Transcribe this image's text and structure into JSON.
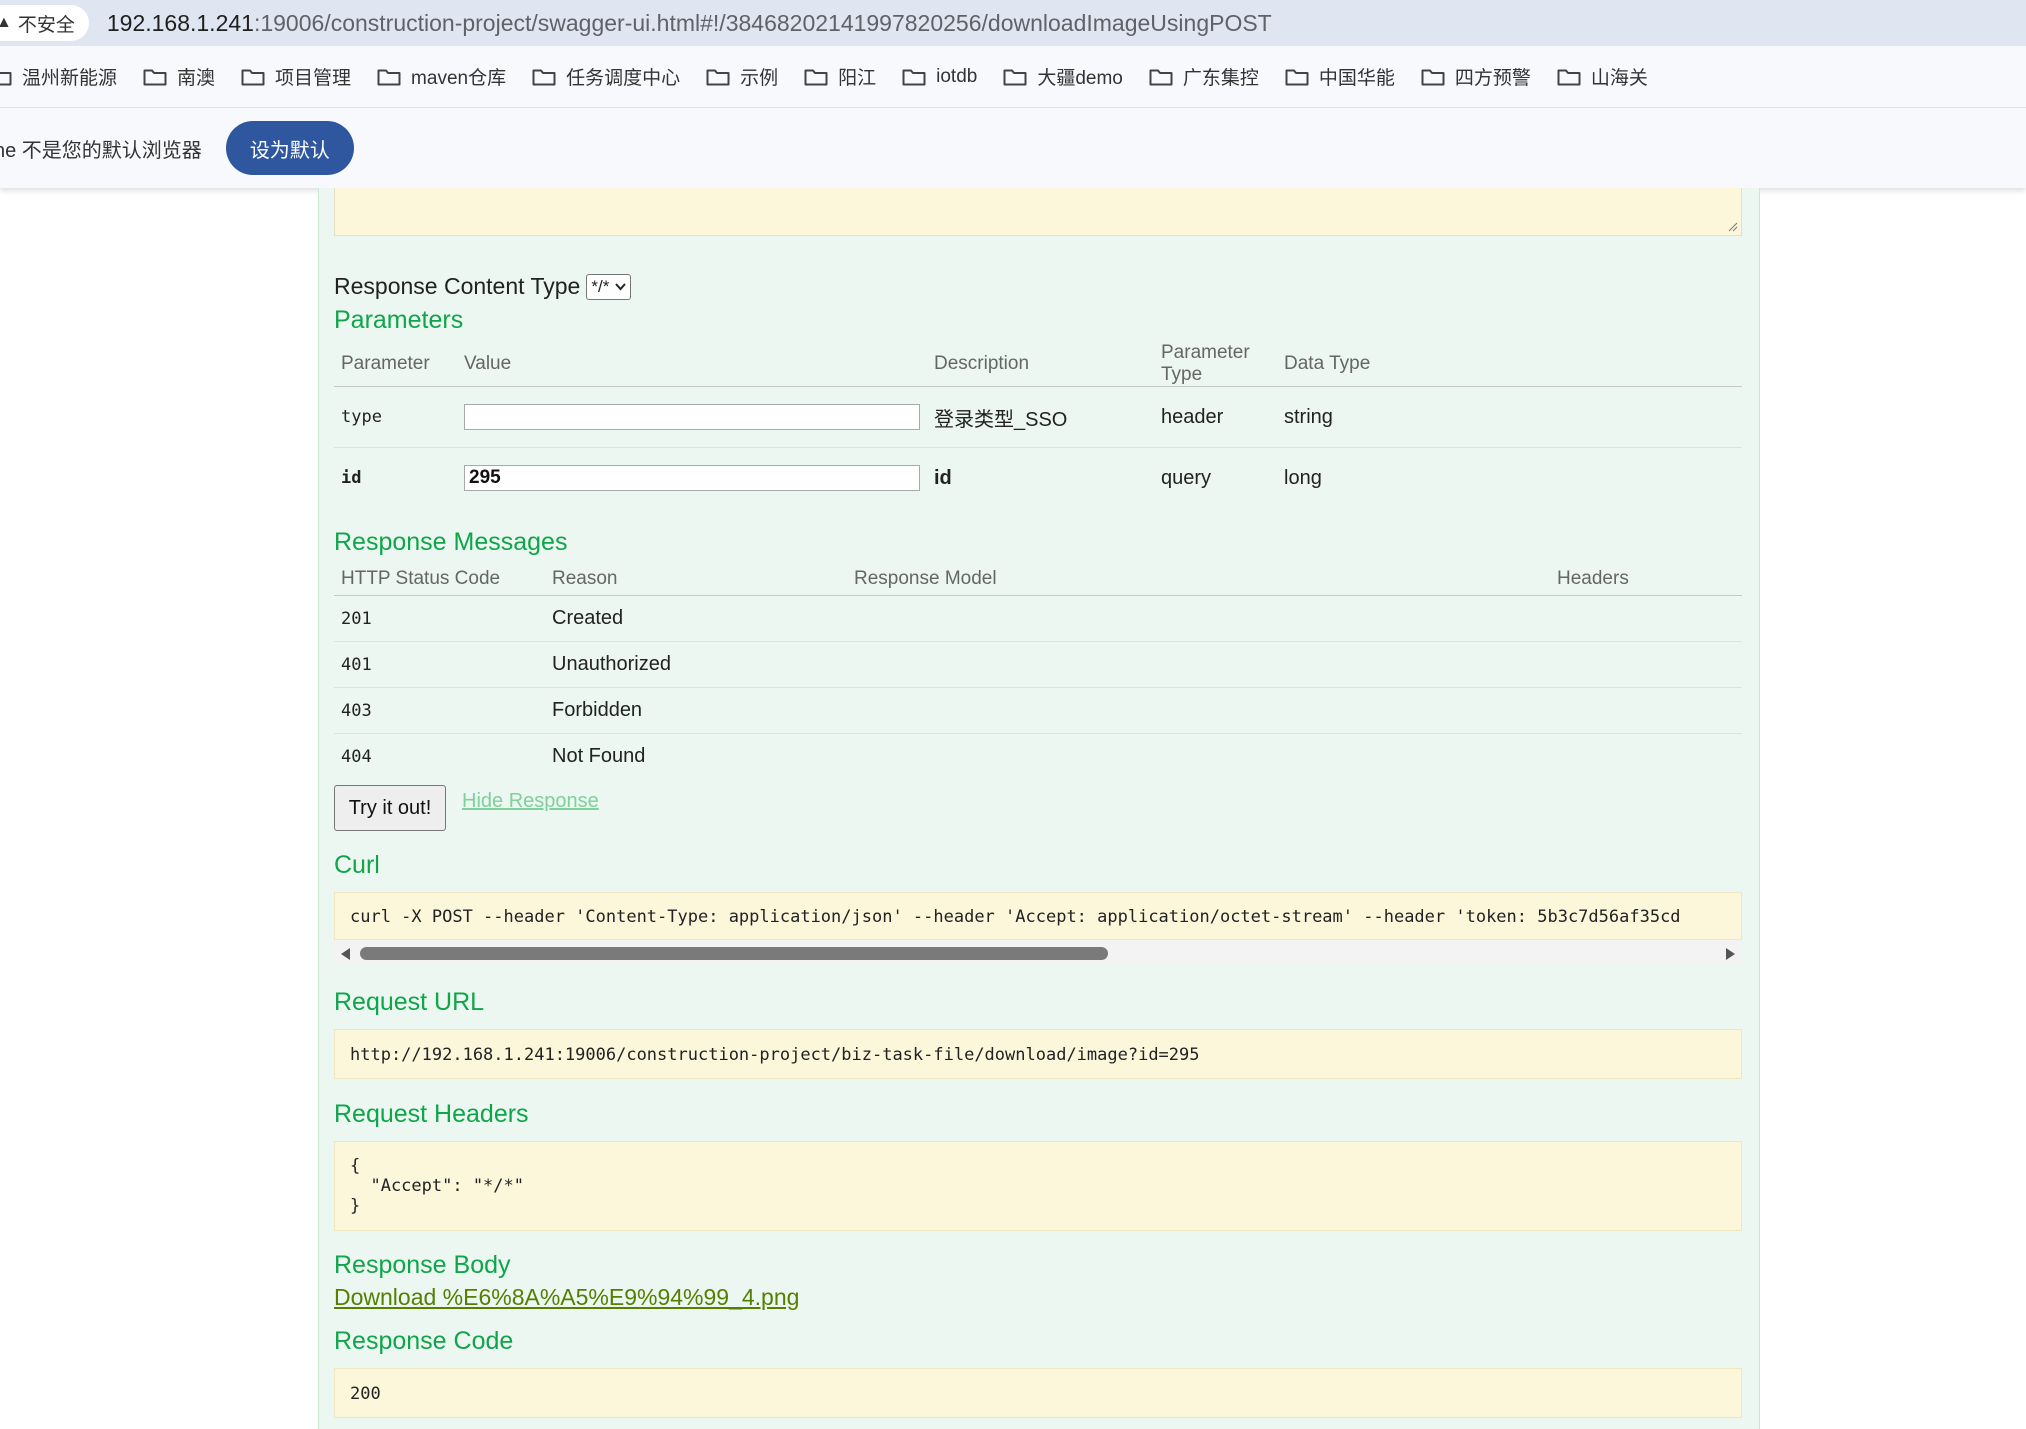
{
  "browser": {
    "security_label": "不安全",
    "url_host": "192.168.1.241",
    "url_rest": ":19006/construction-project/swagger-ui.html#!/3846820214199782025​6/downloadImageUsingPOST",
    "bookmarks": [
      "温州新能源",
      "南澳",
      "项目管理",
      "maven仓库",
      "任务调度中心",
      "示例",
      "阳江",
      "iotdb",
      "大疆demo",
      "广东集控",
      "中国华能",
      "四方预警",
      "山海关"
    ],
    "infobar_message": "ne 不是您的默认浏览器",
    "infobar_button": "设为默认"
  },
  "swagger": {
    "response_content_type_label": "Response Content Type",
    "response_content_type_value": "*/*",
    "parameters_title": "Parameters",
    "param_headers": [
      "Parameter",
      "Value",
      "Description",
      "Parameter Type",
      "Data Type"
    ],
    "params": [
      {
        "name": "type",
        "value": "",
        "description": "登录类型_SSO",
        "param_type": "header",
        "data_type": "string"
      },
      {
        "name": "id",
        "value": "295",
        "description": "id",
        "param_type": "query",
        "data_type": "long"
      }
    ],
    "response_messages_title": "Response Messages",
    "resp_headers": [
      "HTTP Status Code",
      "Reason",
      "Response Model",
      "Headers"
    ],
    "responses": [
      {
        "code": "201",
        "reason": "Created"
      },
      {
        "code": "401",
        "reason": "Unauthorized"
      },
      {
        "code": "403",
        "reason": "Forbidden"
      },
      {
        "code": "404",
        "reason": "Not Found"
      }
    ],
    "try_button": "Try it out!",
    "hide_response": "Hide Response",
    "curl_title": "Curl",
    "curl_text": "curl -X POST --header 'Content-Type: application/json' --header 'Accept: application/octet-stream' --header 'token: 5b3c7d56af35cd",
    "request_url_title": "Request URL",
    "request_url": "http://192.168.1.241:19006/construction-project/biz-task-file/download/image?id=295",
    "request_headers_title": "Request Headers",
    "request_headers_text": "{\n  \"Accept\": \"*/*\"\n}",
    "response_body_title": "Response Body",
    "download_link": "Download %E6%8A%A5%E9%94%99_4.png",
    "response_code_title": "Response Code",
    "response_code": "200"
  }
}
